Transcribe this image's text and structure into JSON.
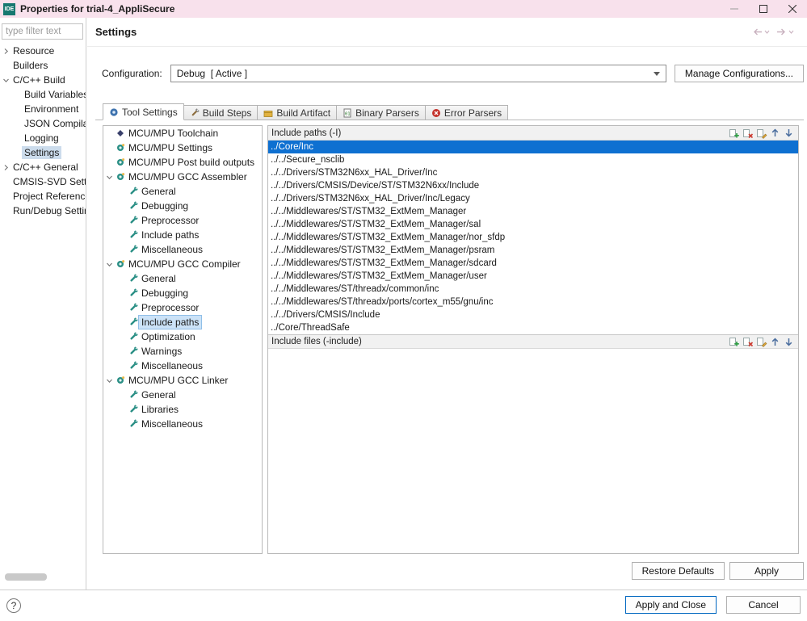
{
  "window": {
    "title": "Properties for trial-4_AppliSecure",
    "app_badge": "IDE"
  },
  "sidebar": {
    "filter_placeholder": "type filter text",
    "tree": [
      {
        "label": "Resource",
        "level": 0,
        "chevron": "collapsed"
      },
      {
        "label": "Builders",
        "level": 0
      },
      {
        "label": "C/C++ Build",
        "level": 0,
        "chevron": "expanded"
      },
      {
        "label": "Build Variables",
        "level": 1
      },
      {
        "label": "Environment",
        "level": 1
      },
      {
        "label": "JSON Compila",
        "level": 1
      },
      {
        "label": "Logging",
        "level": 1
      },
      {
        "label": "Settings",
        "level": 1,
        "selected": true
      },
      {
        "label": "C/C++ General",
        "level": 0,
        "chevron": "collapsed"
      },
      {
        "label": "CMSIS-SVD Settin",
        "level": 0
      },
      {
        "label": "Project Reference",
        "level": 0
      },
      {
        "label": "Run/Debug Settin",
        "level": 0
      }
    ]
  },
  "header": {
    "title": "Settings"
  },
  "configuration": {
    "label": "Configuration:",
    "value": "Debug  [ Active ]",
    "manage_button": "Manage Configurations..."
  },
  "tabs": [
    {
      "label": "Tool Settings",
      "icon": "tool-settings-icon",
      "active": true
    },
    {
      "label": "Build Steps",
      "icon": "build-steps-icon",
      "active": false
    },
    {
      "label": "Build Artifact",
      "icon": "build-artifact-icon",
      "active": false
    },
    {
      "label": "Binary Parsers",
      "icon": "binary-parsers-icon",
      "active": false
    },
    {
      "label": "Error Parsers",
      "icon": "error-parsers-icon",
      "active": false
    }
  ],
  "tool_settings": {
    "tree": [
      {
        "label": "MCU/MPU Toolchain",
        "level": 0,
        "icon": "toolchain-icon"
      },
      {
        "label": "MCU/MPU Settings",
        "level": 0,
        "icon": "gear-icon"
      },
      {
        "label": "MCU/MPU Post build outputs",
        "level": 0,
        "icon": "gear-icon"
      },
      {
        "label": "MCU/MPU GCC Assembler",
        "level": 0,
        "icon": "gear-icon",
        "chevron": "expanded"
      },
      {
        "label": "General",
        "level": 1,
        "icon": "wrench-icon"
      },
      {
        "label": "Debugging",
        "level": 1,
        "icon": "wrench-icon"
      },
      {
        "label": "Preprocessor",
        "level": 1,
        "icon": "wrench-icon"
      },
      {
        "label": "Include paths",
        "level": 1,
        "icon": "wrench-icon"
      },
      {
        "label": "Miscellaneous",
        "level": 1,
        "icon": "wrench-icon"
      },
      {
        "label": "MCU/MPU GCC Compiler",
        "level": 0,
        "icon": "gear-icon",
        "chevron": "expanded"
      },
      {
        "label": "General",
        "level": 1,
        "icon": "wrench-icon"
      },
      {
        "label": "Debugging",
        "level": 1,
        "icon": "wrench-icon"
      },
      {
        "label": "Preprocessor",
        "level": 1,
        "icon": "wrench-icon"
      },
      {
        "label": "Include paths",
        "level": 1,
        "icon": "wrench-icon",
        "selected": true
      },
      {
        "label": "Optimization",
        "level": 1,
        "icon": "wrench-icon"
      },
      {
        "label": "Warnings",
        "level": 1,
        "icon": "wrench-icon"
      },
      {
        "label": "Miscellaneous",
        "level": 1,
        "icon": "wrench-icon"
      },
      {
        "label": "MCU/MPU GCC Linker",
        "level": 0,
        "icon": "gear-icon",
        "chevron": "expanded"
      },
      {
        "label": "General",
        "level": 1,
        "icon": "wrench-icon"
      },
      {
        "label": "Libraries",
        "level": 1,
        "icon": "wrench-icon"
      },
      {
        "label": "Miscellaneous",
        "level": 1,
        "icon": "wrench-icon"
      }
    ]
  },
  "include_paths": {
    "title": "Include paths (-I)",
    "selected_index": 0,
    "items": [
      "../Core/Inc",
      "../../Secure_nsclib",
      "../../Drivers/STM32N6xx_HAL_Driver/Inc",
      "../../Drivers/CMSIS/Device/ST/STM32N6xx/Include",
      "../../Drivers/STM32N6xx_HAL_Driver/Inc/Legacy",
      "../../Middlewares/ST/STM32_ExtMem_Manager",
      "../../Middlewares/ST/STM32_ExtMem_Manager/sal",
      "../../Middlewares/ST/STM32_ExtMem_Manager/nor_sfdp",
      "../../Middlewares/ST/STM32_ExtMem_Manager/psram",
      "../../Middlewares/ST/STM32_ExtMem_Manager/sdcard",
      "../../Middlewares/ST/STM32_ExtMem_Manager/user",
      "../../Middlewares/ST/threadx/common/inc",
      "../../Middlewares/ST/threadx/ports/cortex_m55/gnu/inc",
      "../../Drivers/CMSIS/Include",
      "../Core/ThreadSafe"
    ]
  },
  "include_files": {
    "title": "Include files (-include)",
    "items": []
  },
  "actions": {
    "restore_defaults": "Restore Defaults",
    "apply": "Apply",
    "apply_and_close": "Apply and Close",
    "cancel": "Cancel",
    "help": "?"
  },
  "colors": {
    "titlebar_pink": "#f8e1ec",
    "selection_blue": "#0e70d1",
    "tree_selection_blue": "#cbe2f7",
    "sidebar_selection_gray": "#ccdcec",
    "accent_teal": "#177870",
    "error_red": "#c4322b"
  }
}
